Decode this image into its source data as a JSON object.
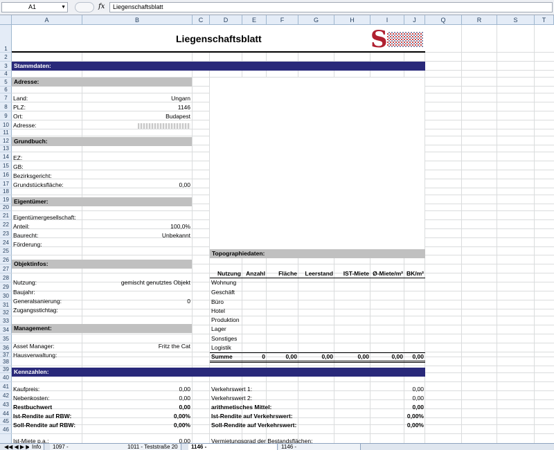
{
  "formula_bar": {
    "cell_ref": "A1",
    "fx": "fx",
    "content": "Liegenschaftsblatt"
  },
  "columns": [
    "A",
    "B",
    "C",
    "D",
    "E",
    "F",
    "G",
    "H",
    "I",
    "J",
    "Q",
    "R",
    "S",
    "T"
  ],
  "rows": [
    "1",
    "2",
    "3",
    "4",
    "5",
    "6",
    "7",
    "8",
    "9",
    "10",
    "11",
    "12",
    "13",
    "14",
    "15",
    "16",
    "17",
    "18",
    "19",
    "20",
    "21",
    "22",
    "23",
    "24",
    "25",
    "26",
    "27",
    "28",
    "29",
    "30",
    "31",
    "32",
    "33",
    "34",
    "35",
    "36",
    "37",
    "38",
    "39",
    "40",
    "41",
    "42",
    "43",
    "44",
    "45",
    "46"
  ],
  "title": "Liegenschaftsblatt",
  "sections": {
    "stammdaten": "Stammdaten:",
    "adresse": "Adresse:",
    "grundbuch": "Grundbuch:",
    "eigentuemer": "Eigentümer:",
    "objektinfos": "Objektinfos:",
    "management": "Management:",
    "kennzahlen": "Kennzahlen:",
    "topographie": "Topographiedaten:"
  },
  "adresse": {
    "land_label": "Land:",
    "land": "Ungarn",
    "plz_label": "PLZ:",
    "plz": "1146",
    "ort_label": "Ort:",
    "ort": "Budapest",
    "adresse_label": "Adresse:"
  },
  "grundbuch": {
    "ez": "EZ:",
    "gb": "GB:",
    "bezirksgericht": "Bezirksgericht:",
    "flaeche_label": "Grundstücksfläche:",
    "flaeche": "0,00"
  },
  "eigentuemer": {
    "gesellschaft": "Eigentümergesellschaft:",
    "anteil_label": "Anteil:",
    "anteil": "100,0%",
    "baurecht_label": "Baurecht:",
    "baurecht": "Unbekannt",
    "foerderung": "Förderung:"
  },
  "objekt": {
    "nutzung_label": "Nutzung:",
    "nutzung": "gemischt genutztes Objekt",
    "baujahr": "Baujahr:",
    "sanierung_label": "Generalsanierung:",
    "sanierung": "0",
    "zugang": "Zugangsstichtag:"
  },
  "management": {
    "asset_label": "Asset Manager:",
    "asset": "Fritz the Cat",
    "haus": "Hausverwaltung:"
  },
  "topo": {
    "headers": [
      "Nutzung",
      "Anzahl",
      "Fläche",
      "Leerstand",
      "IST-Miete",
      "Ø-Miete/m²",
      "BK/m²"
    ],
    "rows": [
      "Wohnung",
      "Geschäft",
      "Büro",
      "Hotel",
      "Produktion",
      "Lager",
      "Sonstiges",
      "Logistik"
    ],
    "summe": {
      "label": "Summe",
      "anzahl": "0",
      "flaeche": "0,00",
      "leer": "0,00",
      "ist": "0,00",
      "avg": "0,00",
      "bk": "0,00"
    }
  },
  "kennzahlen": {
    "kaufpreis_label": "Kaufpreis:",
    "kaufpreis": "0,00",
    "nebenkosten_label": "Nebenkosten:",
    "nebenkosten": "0,00",
    "rbw_label": "Restbuchwert",
    "rbw": "0,00",
    "ist_rbw_label": "Ist-Rendite auf RBW:",
    "ist_rbw": "0,00%",
    "soll_rbw_label": "Soll-Rendite auf RBW:",
    "soll_rbw": "0,00%",
    "ist_miete_label": "Ist-Miete p.a.:",
    "ist_miete": "0,00",
    "vw1_label": "Verkehrswert 1:",
    "vw1": "0,00",
    "vw2_label": "Verkehrswert 2:",
    "vw2": "0,00",
    "mittel_label": "arithmetisches Mittel:",
    "mittel": "0,00",
    "ist_vw_label": "Ist-Rendite auf Verkehrswert:",
    "ist_vw": "0,00%",
    "soll_vw_label": "Soll-Rendite auf Verkehrswert:",
    "soll_vw": "0,00%",
    "vermietung_label": "Vermietungsgrad der Bestandsflächen:"
  },
  "sheet_tabs": [
    "Info",
    "1097 -",
    "1011 - Teststraße 20",
    "1146 -",
    "1146 -"
  ],
  "colors": {
    "band": "#29297a",
    "gray": "#c0c0c0",
    "header": "#e4ecf7"
  }
}
